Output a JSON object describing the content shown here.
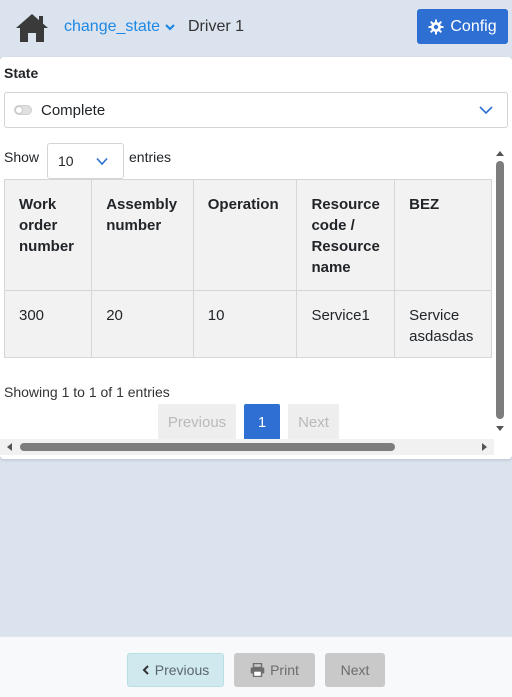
{
  "header": {
    "nav_dropdown_label": "change_state",
    "title": "Driver 1",
    "config_label": "Config"
  },
  "state": {
    "label": "State",
    "value": "Complete"
  },
  "table": {
    "show_label": "Show",
    "page_size": "10",
    "entries_label": "entries",
    "columns": [
      [
        "Work",
        "order",
        "number"
      ],
      [
        "Assembly",
        "number"
      ],
      [
        "Operation"
      ],
      [
        "Resource",
        "code /",
        "Resource",
        "name"
      ],
      [
        "BEZ"
      ]
    ],
    "rows": [
      {
        "work_order_number": "300",
        "assembly_number": "20",
        "operation": "10",
        "resource": "Service1",
        "bez": [
          "Service",
          "asdasdas"
        ]
      }
    ],
    "info": "Showing 1 to 1 of 1 entries",
    "pagination": {
      "previous": "Previous",
      "current": "1",
      "next": "Next"
    }
  },
  "footer": {
    "previous_label": "Previous",
    "print_label": "Print",
    "next_label": "Next"
  },
  "colors": {
    "accent": "#2d6fd3",
    "link": "#1e88e5",
    "background": "#dbe3ee"
  }
}
